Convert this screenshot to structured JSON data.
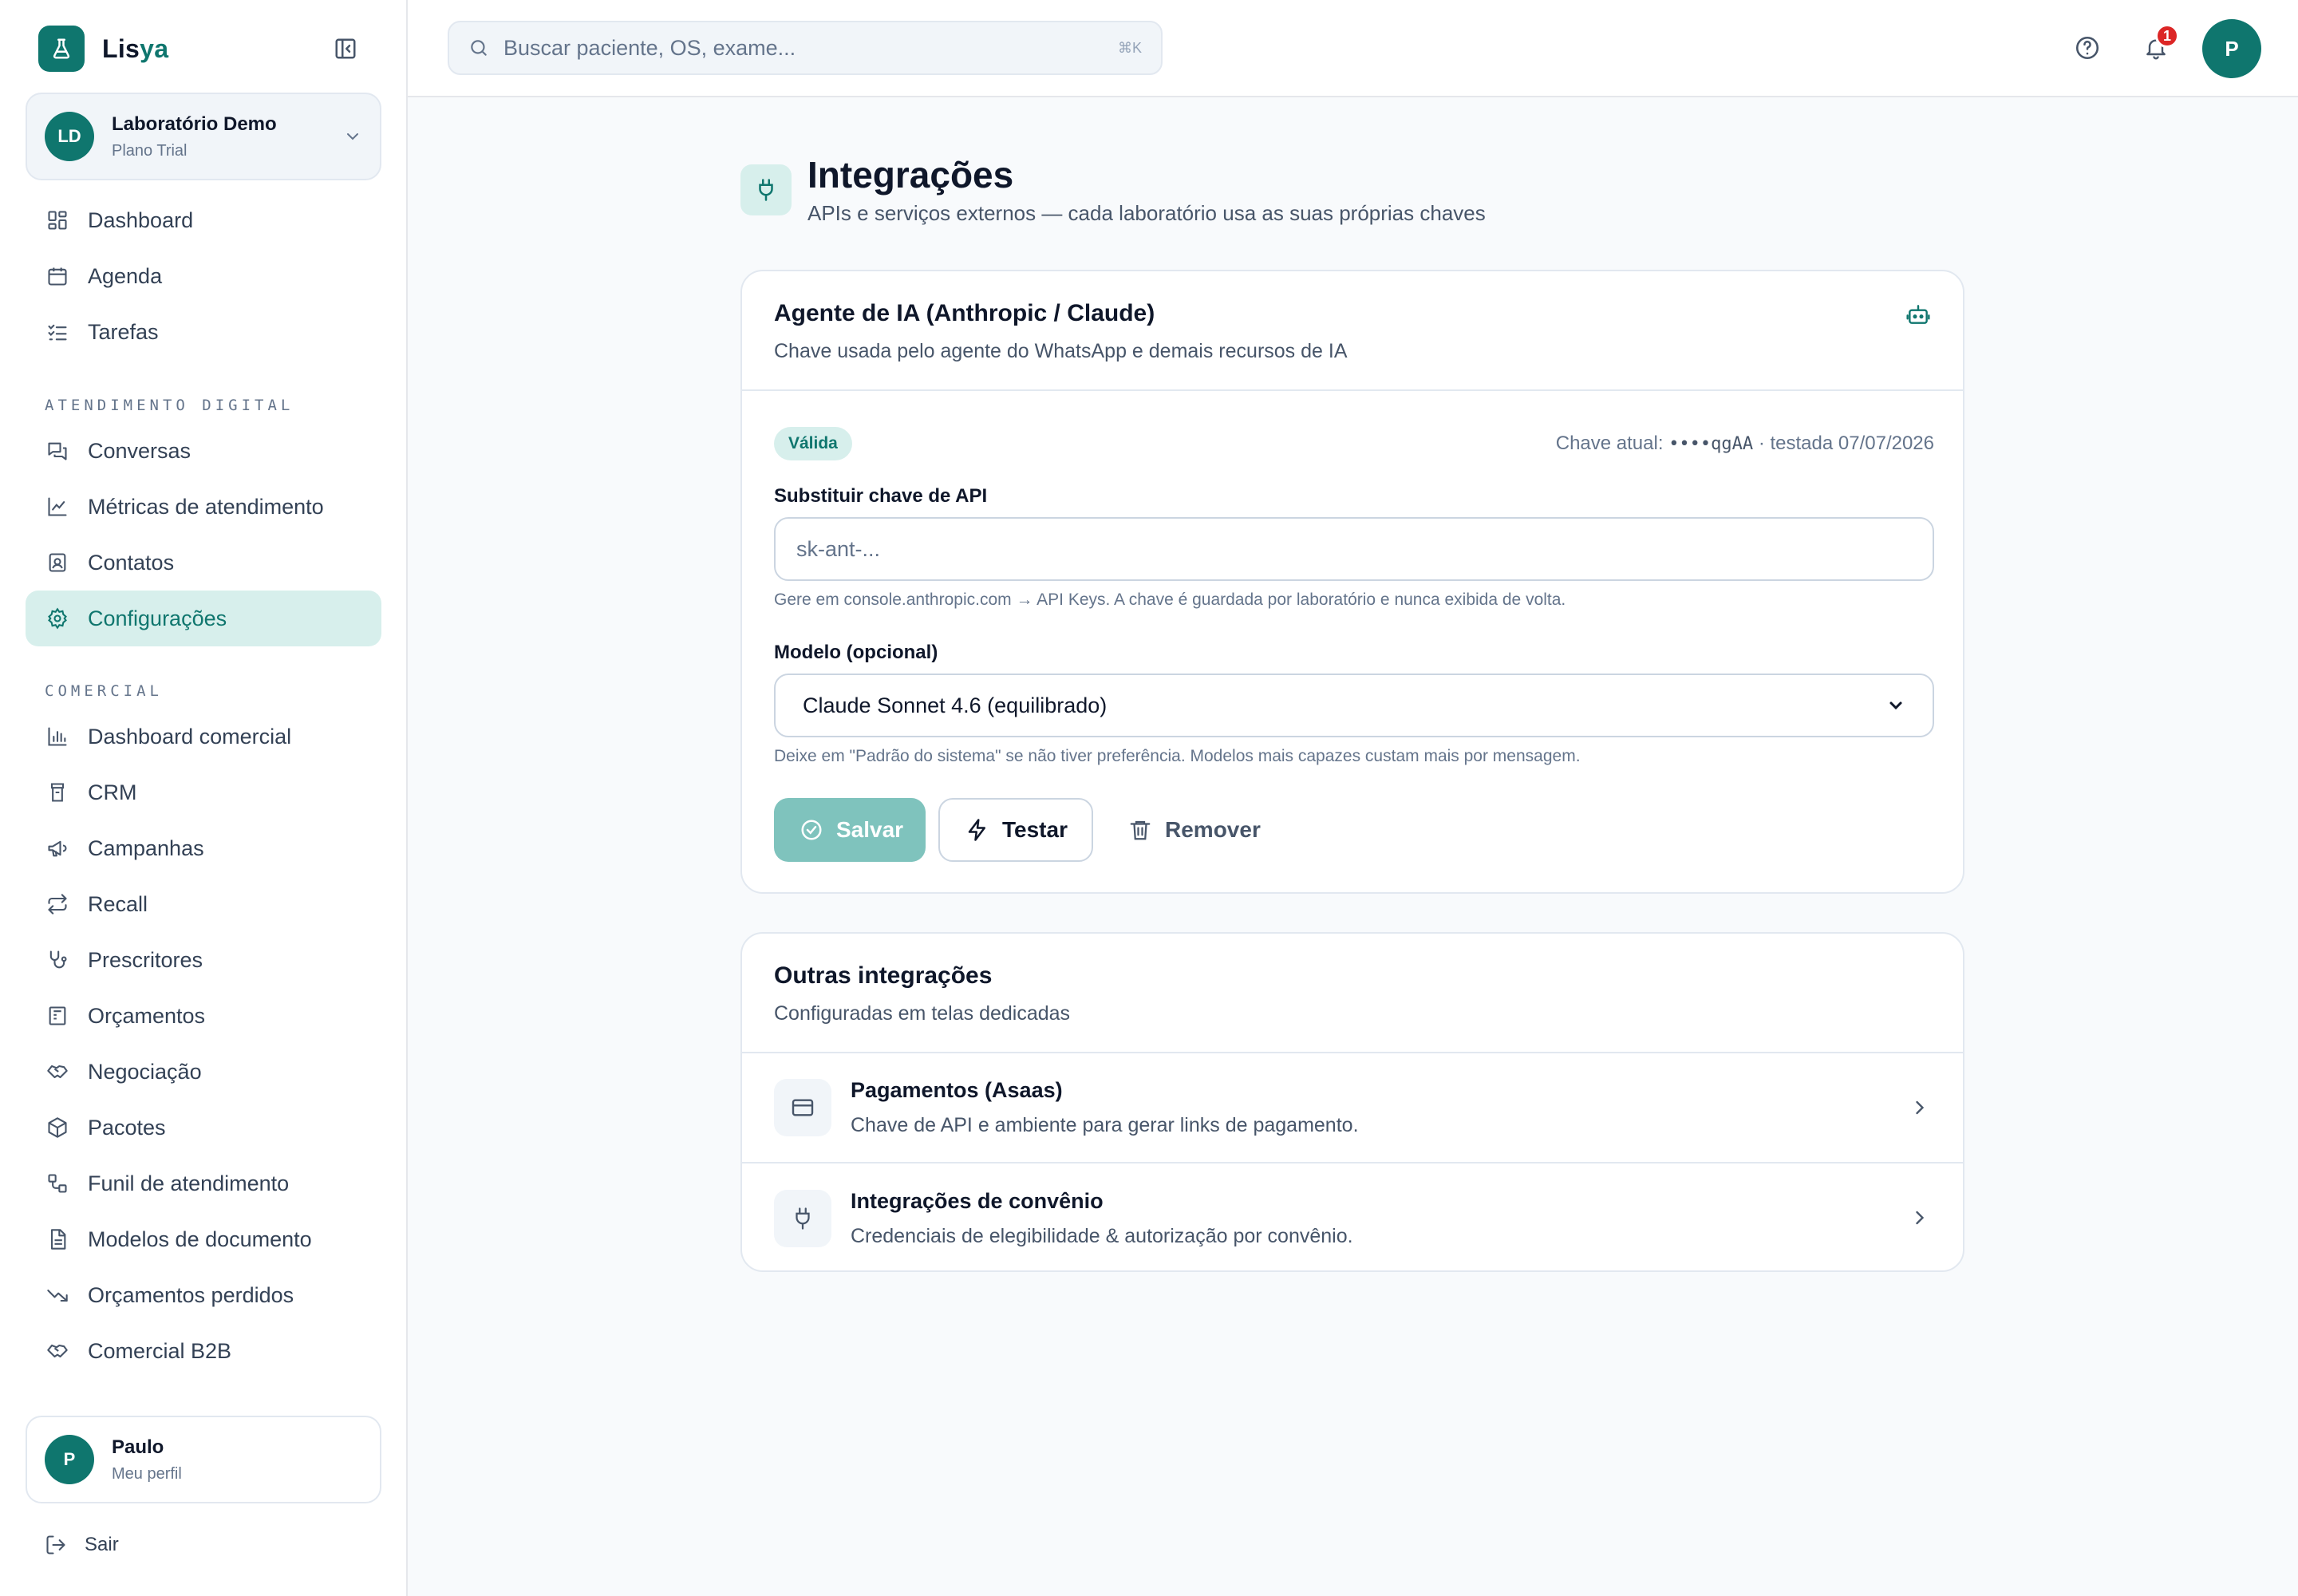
{
  "brand": {
    "name_part1": "Lis",
    "name_part2": "ya"
  },
  "org": {
    "initials": "LD",
    "name": "Laboratório Demo",
    "plan": "Plano Trial"
  },
  "nav_main": [
    {
      "label": "Dashboard",
      "icon": "dashboard-icon"
    },
    {
      "label": "Agenda",
      "icon": "calendar-icon"
    },
    {
      "label": "Tarefas",
      "icon": "checklist-icon"
    }
  ],
  "section_digital": "ATENDIMENTO DIGITAL",
  "nav_digital": [
    {
      "label": "Conversas",
      "icon": "chat-icon"
    },
    {
      "label": "Métricas de atendimento",
      "icon": "line-chart-icon"
    },
    {
      "label": "Contatos",
      "icon": "contact-icon"
    },
    {
      "label": "Configurações",
      "icon": "gear-icon",
      "active": true
    }
  ],
  "section_comercial": "COMERCIAL",
  "nav_comercial": [
    {
      "label": "Dashboard comercial",
      "icon": "bar-chart-icon"
    },
    {
      "label": "CRM",
      "icon": "crm-icon"
    },
    {
      "label": "Campanhas",
      "icon": "megaphone-icon"
    },
    {
      "label": "Recall",
      "icon": "repeat-icon"
    },
    {
      "label": "Prescritores",
      "icon": "stethoscope-icon"
    },
    {
      "label": "Orçamentos",
      "icon": "receipt-icon"
    },
    {
      "label": "Negociação",
      "icon": "handshake-icon"
    },
    {
      "label": "Pacotes",
      "icon": "package-icon"
    },
    {
      "label": "Funil de atendimento",
      "icon": "workflow-icon"
    },
    {
      "label": "Modelos de documento",
      "icon": "document-icon"
    },
    {
      "label": "Orçamentos perdidos",
      "icon": "trending-down-icon"
    },
    {
      "label": "Comercial B2B",
      "icon": "handshake-icon"
    }
  ],
  "user": {
    "initial": "P",
    "name": "Paulo",
    "sub": "Meu perfil"
  },
  "logout_label": "Sair",
  "search": {
    "placeholder": "Buscar paciente, OS, exame...",
    "shortcut": "⌘K"
  },
  "notifications_count": "1",
  "top_avatar": "P",
  "page": {
    "title": "Integrações",
    "subtitle": "APIs e serviços externos — cada laboratório usa as suas próprias chaves"
  },
  "ai_card": {
    "title": "Agente de IA (Anthropic / Claude)",
    "subtitle": "Chave usada pelo agente do WhatsApp e demais recursos de IA",
    "status": "Válida",
    "key_prefix": "Chave atual:",
    "key_masked": "••••qgAA",
    "key_tested": "· testada 07/07/2026",
    "api_label": "Substituir chave de API",
    "api_placeholder": "sk-ant-...",
    "api_hint": "Gere em console.anthropic.com → API Keys. A chave é guardada por laboratório e nunca exibida de volta.",
    "model_label": "Modelo (opcional)",
    "model_value": "Claude Sonnet 4.6 (equilibrado)",
    "model_hint": "Deixe em \"Padrão do sistema\" se não tiver preferência. Modelos mais capazes custam mais por mensagem.",
    "save_label": "Salvar",
    "test_label": "Testar",
    "remove_label": "Remover"
  },
  "other_card": {
    "title": "Outras integrações",
    "subtitle": "Configuradas em telas dedicadas",
    "items": [
      {
        "title": "Pagamentos (Asaas)",
        "subtitle": "Chave de API e ambiente para gerar links de pagamento.",
        "icon": "credit-card-icon"
      },
      {
        "title": "Integrações de convênio",
        "subtitle": "Credenciais de elegibilidade & autorização por convênio.",
        "icon": "plug-icon"
      }
    ]
  },
  "colors": {
    "brand": "#0f766e",
    "active_bg": "#d7efec",
    "danger": "#dc2626"
  }
}
